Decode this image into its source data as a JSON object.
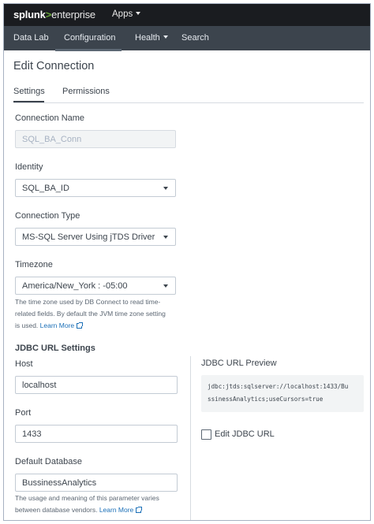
{
  "topbar": {
    "logo_splunk": "splunk",
    "logo_gt": ">",
    "logo_enterprise": "enterprise",
    "apps_label": "Apps"
  },
  "nav": {
    "items": [
      {
        "label": "Data Lab"
      },
      {
        "label": "Configuration",
        "active": true
      },
      {
        "label": "Health",
        "has_dropdown": true
      },
      {
        "label": "Search"
      }
    ]
  },
  "page": {
    "title": "Edit Connection",
    "tabs": [
      {
        "label": "Settings",
        "active": true
      },
      {
        "label": "Permissions"
      }
    ]
  },
  "form": {
    "connection_name": {
      "label": "Connection Name",
      "placeholder": "SQL_BA_Conn",
      "disabled": true
    },
    "identity": {
      "label": "Identity",
      "value": "SQL_BA_ID"
    },
    "connection_type": {
      "label": "Connection Type",
      "value": "MS-SQL Server Using jTDS Driver"
    },
    "timezone": {
      "label": "Timezone",
      "value": "America/New_York : -05:00",
      "help_line1": "The time zone used by DB Connect to read time-",
      "help_line2": "related fields. By default the JVM time zone setting",
      "help_line3_prefix": "is used. ",
      "help_link": "Learn More"
    }
  },
  "jdbc": {
    "section_title": "JDBC URL Settings",
    "host": {
      "label": "Host",
      "value": "localhost"
    },
    "port": {
      "label": "Port",
      "value": "1433"
    },
    "default_database": {
      "label": "Default Database",
      "value": "BussinessAnalytics",
      "help_line1": "The usage and meaning of this parameter varies",
      "help_line2_prefix": "between database vendors. ",
      "help_link": "Learn More"
    },
    "preview": {
      "label": "JDBC URL Preview",
      "line1": "jdbc:jtds:sqlserver://localhost:1433/Bu",
      "line2": "ssinessAnalytics;useCursors=true"
    },
    "edit_url": {
      "label": "Edit JDBC URL",
      "checked": false
    }
  },
  "colors": {
    "topbar_bg": "#1a1c20",
    "navbar_bg": "#3c444d",
    "brand_green": "#65a637",
    "link_blue": "#1a6fb7",
    "text": "#3c444d"
  }
}
